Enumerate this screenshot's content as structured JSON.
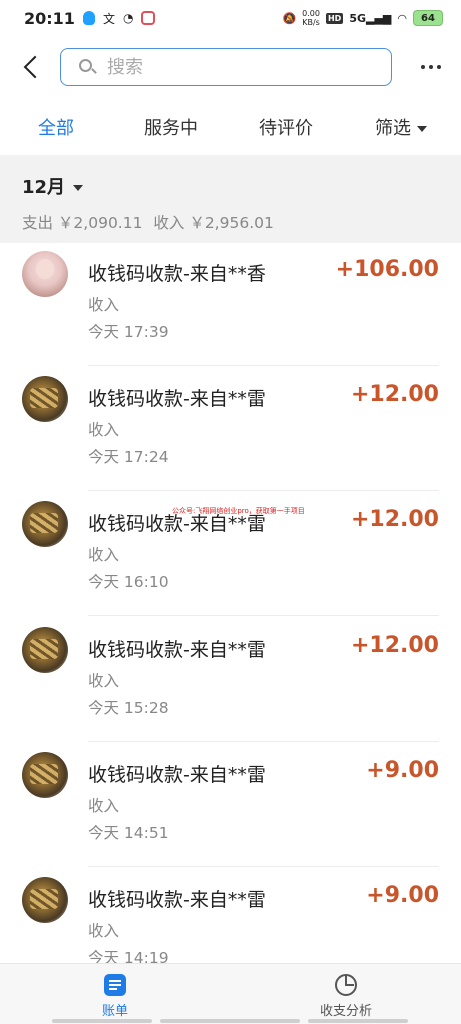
{
  "status_bar": {
    "time": "20:11",
    "net_speed_value": "0.00",
    "net_speed_unit": "KB/s",
    "hd": "HD",
    "signal": "5G",
    "battery": "64"
  },
  "search": {
    "placeholder": "搜索"
  },
  "tabs": [
    {
      "label": "全部",
      "active": true
    },
    {
      "label": "服务中",
      "active": false
    },
    {
      "label": "待评价",
      "active": false
    },
    {
      "label": "筛选",
      "active": false
    }
  ],
  "summary": {
    "month": "12月",
    "expense": "支出 ￥2,090.11",
    "income": "收入 ￥2,956.01"
  },
  "transactions": [
    {
      "title": "收钱码收款-来自**香",
      "amount": "+106.00",
      "type": "收入",
      "time": "今天  17:39",
      "avatar": "girl-avatar"
    },
    {
      "title": "收钱码收款-来自**雷",
      "amount": "+12.00",
      "type": "收入",
      "time": "今天  17:24",
      "avatar": "food-avatar"
    },
    {
      "title": "收钱码收款-来自**雷",
      "amount": "+12.00",
      "type": "收入",
      "time": "今天  16:10",
      "avatar": "food-avatar"
    },
    {
      "title": "收钱码收款-来自**雷",
      "amount": "+12.00",
      "type": "收入",
      "time": "今天  15:28",
      "avatar": "food-avatar"
    },
    {
      "title": "收钱码收款-来自**雷",
      "amount": "+9.00",
      "type": "收入",
      "time": "今天  14:51",
      "avatar": "food-avatar"
    },
    {
      "title": "收钱码收款-来自**雷",
      "amount": "+9.00",
      "type": "收入",
      "time": "今天  14:19",
      "avatar": "food-avatar"
    }
  ],
  "watermark": "公众号:飞翔网络创业pro，获取第一手项目",
  "bottom_nav": {
    "bill": "账单",
    "analysis": "收支分析"
  },
  "colors": {
    "accent": "#1f7ce6",
    "amount": "#c9552a",
    "summary_bg": "#f2f2f2"
  }
}
